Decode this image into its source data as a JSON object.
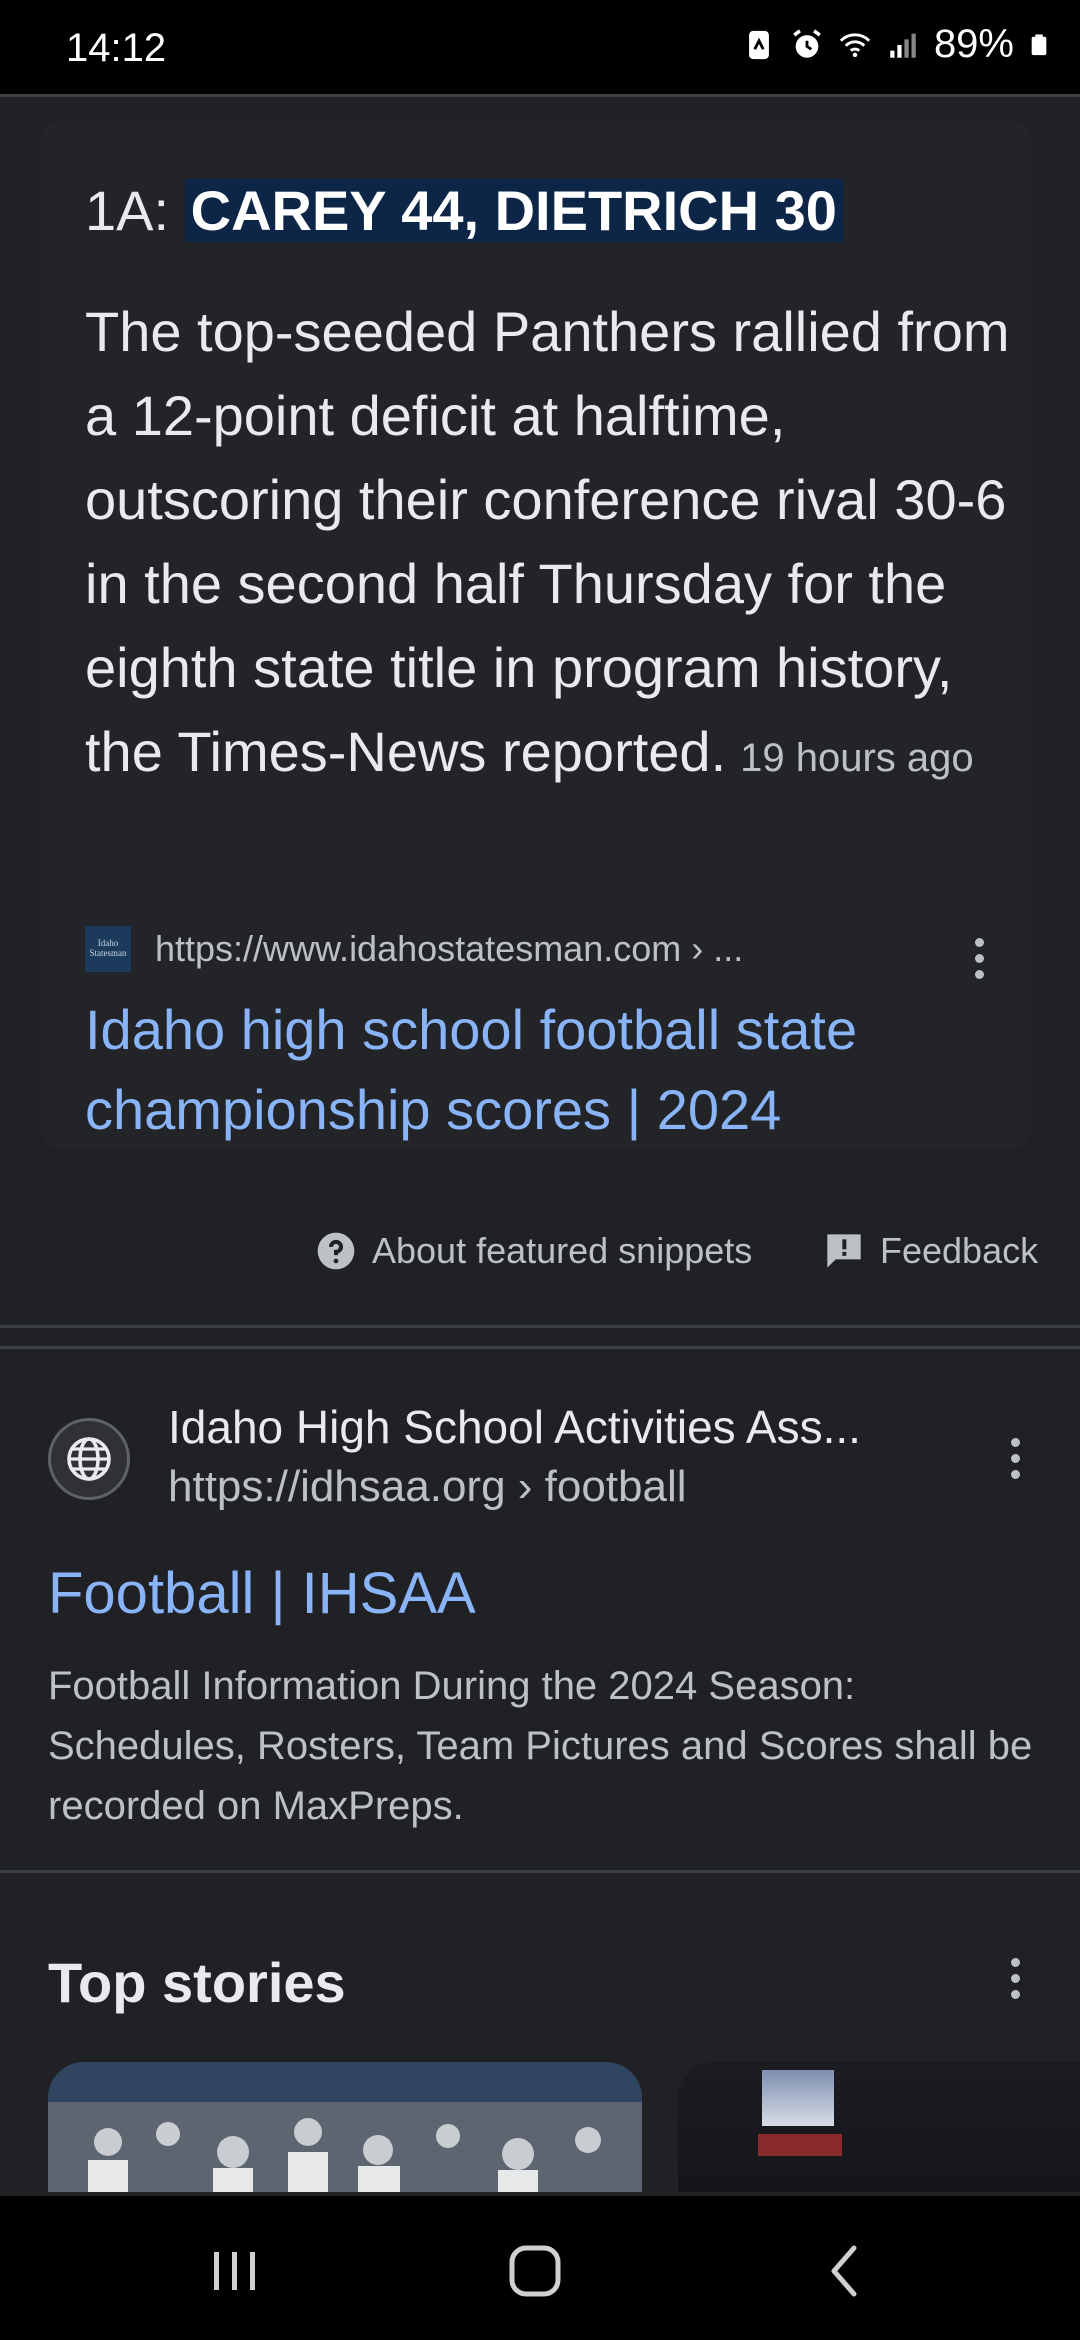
{
  "status_bar": {
    "time": "14:12",
    "battery": "89%",
    "icons": [
      "nfc-icon",
      "alarm-icon",
      "wifi-icon",
      "signal-icon",
      "battery-icon"
    ]
  },
  "featured_snippet": {
    "title_prefix": "1A: ",
    "title_highlight": "CAREY 44, DIETRICH 30",
    "body": "The top-seeded Panthers rallied from a 12-point deficit at halftime, outscoring their conference rival 30-6 in the second half Thursday for the eighth state title in program history, the Times-News reported.",
    "time_ago": "19 hours ago",
    "source_favicon_text": "Idaho Statesman",
    "source_url": "https://www.idahostatesman.com › ...",
    "source_title": "Idaho high school football state championship scores | 2024"
  },
  "snippet_footer": {
    "about_label": "About featured snippets",
    "feedback_label": "Feedback"
  },
  "result": {
    "site_name": "Idaho High School Activities Ass...",
    "url": "https://idhsaa.org › football",
    "title": "Football | IHSAA",
    "description": "Football Information During the 2024 Season: Schedules, Rosters, Team Pictures and Scores shall be recorded on MaxPreps."
  },
  "top_stories": {
    "heading": "Top stories"
  },
  "colors": {
    "background": "#202124",
    "link": "#8ab4f8",
    "highlight": "#0d2546"
  }
}
